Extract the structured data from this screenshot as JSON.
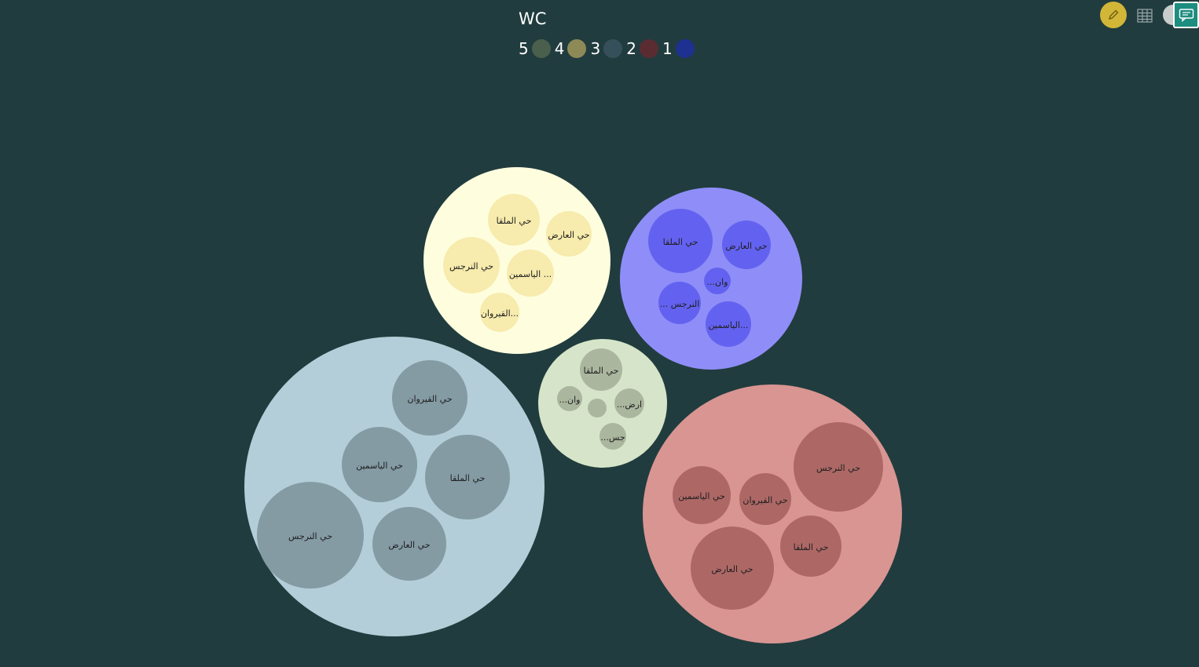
{
  "legend": {
    "title": "WC",
    "items": [
      {
        "label": "5",
        "color": "#4a5f4c"
      },
      {
        "label": "4",
        "color": "#8e8a57"
      },
      {
        "label": "3",
        "color": "#35505a"
      },
      {
        "label": "2",
        "color": "#5a2c31"
      },
      {
        "label": "1",
        "color": "#1e3190"
      }
    ]
  },
  "toolbar": {
    "edit_icon": "pencil-icon",
    "table_icon": "table-grid-icon",
    "chat_icon": "comment-icon"
  },
  "chart_data": {
    "type": "packed-bubble",
    "legend_title": "WC",
    "groups": [
      {
        "wc": "5",
        "color": "#b3ced8",
        "child_color": "#7b929b",
        "children": [
          {
            "label": "حي القيروان",
            "value": 2.2
          },
          {
            "label": "حي الياسمين",
            "value": 2.2
          },
          {
            "label": "حي الملقا",
            "value": 2.7
          },
          {
            "label": "حي النرجس",
            "value": 4.5
          },
          {
            "label": "حي العارض",
            "value": 2.2
          }
        ]
      },
      {
        "wc": "4",
        "color": "#fefedf",
        "child_color": "#f6e8a4",
        "children": [
          {
            "label": "حي الملقا",
            "value": 1.0
          },
          {
            "label": "حي العارض",
            "value": 0.8
          },
          {
            "label": "حي النرجس",
            "value": 1.2
          },
          {
            "label": "الياسمين ...",
            "value": 0.8
          },
          {
            "label": "القيروان...",
            "value": 0.6
          }
        ]
      },
      {
        "wc": "3",
        "color": "#d6e5c9",
        "child_color": "#a3ae98",
        "children": [
          {
            "label": "حي الملقا",
            "value": 0.7
          },
          {
            "label": "...وان",
            "value": 0.25
          },
          {
            "label": "",
            "value": 0.18
          },
          {
            "label": "...ارض",
            "value": 0.36
          },
          {
            "label": "...جس",
            "value": 0.28
          }
        ]
      },
      {
        "wc": "1",
        "color": "#8f8ef8",
        "child_color": "#5c5aee",
        "children": [
          {
            "label": "حي الملقا",
            "value": 1.7
          },
          {
            "label": "حي العارض",
            "value": 0.9
          },
          {
            "label": "...وان",
            "value": 0.3
          },
          {
            "label": "... النرجس",
            "value": 0.7
          },
          {
            "label": "الياسمين...",
            "value": 0.8
          }
        ]
      },
      {
        "wc": "2",
        "color": "#d99592",
        "child_color": "#a4605e",
        "children": [
          {
            "label": "حي النرجس",
            "value": 3.2
          },
          {
            "label": "حي الياسمين",
            "value": 1.3
          },
          {
            "label": "حي القيروان",
            "value": 1.1
          },
          {
            "label": "حي الملقا",
            "value": 1.5
          },
          {
            "label": "حي العارض",
            "value": 2.8
          }
        ]
      }
    ]
  }
}
